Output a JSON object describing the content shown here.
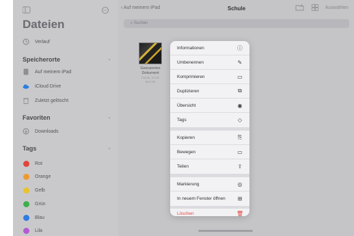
{
  "sidebar": {
    "title": "Dateien",
    "recents": "Verlauf",
    "locations_header": "Speicherorte",
    "locations": [
      "Auf meinem iPad",
      "iCloud Drive",
      "Zuletzt gelöscht"
    ],
    "favorites_header": "Favoriten",
    "favorites": [
      "Downloads"
    ],
    "tags_header": "Tags",
    "tags": [
      {
        "label": "Rot",
        "color": "#e0453a"
      },
      {
        "label": "Orange",
        "color": "#f09a2d"
      },
      {
        "label": "Gelb",
        "color": "#e8c32c"
      },
      {
        "label": "Grün",
        "color": "#3db04a"
      },
      {
        "label": "Blau",
        "color": "#2e7de0"
      },
      {
        "label": "Lila",
        "color": "#b45ad2"
      }
    ]
  },
  "header": {
    "back_label": "Auf meinem iPad",
    "title": "Schule",
    "select_label": "Auswählen"
  },
  "search": {
    "placeholder": "Suchen"
  },
  "file": {
    "name_line1": "Gescanntes",
    "name_line2": "Dokument",
    "date": "Heute, 11:15",
    "size": "554 KB"
  },
  "context_menu": {
    "items": [
      {
        "label": "Informationen",
        "icon": "info-icon"
      },
      {
        "label": "Umbenennen",
        "icon": "pencil-icon"
      },
      {
        "label": "Komprimieren",
        "icon": "archive-icon"
      },
      {
        "label": "Duplizieren",
        "icon": "duplicate-icon"
      },
      {
        "label": "Übersicht",
        "icon": "eye-icon"
      },
      {
        "label": "Tags",
        "icon": "tag-icon"
      },
      {
        "label": "Kopieren",
        "icon": "copy-icon"
      },
      {
        "label": "Bewegen",
        "icon": "folder-icon"
      },
      {
        "label": "Teilen",
        "icon": "share-icon"
      },
      {
        "label": "Markierung",
        "icon": "markup-icon"
      },
      {
        "label": "In neuem Fenster öffnen",
        "icon": "new-window-icon"
      },
      {
        "label": "Löschen",
        "icon": "trash-icon",
        "destructive": true
      }
    ]
  }
}
